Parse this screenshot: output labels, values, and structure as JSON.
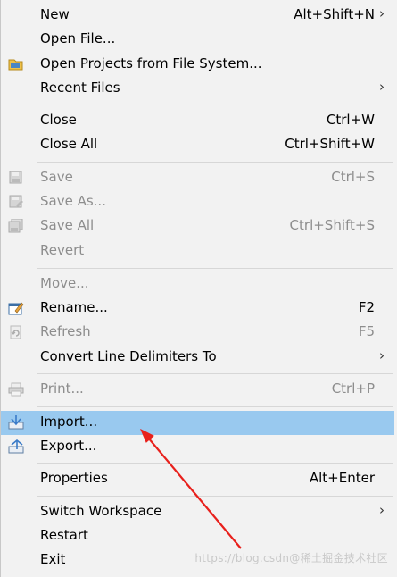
{
  "menu": {
    "new": {
      "label": "New",
      "shortcut": "Alt+Shift+N"
    },
    "open_file": {
      "label": "Open File..."
    },
    "open_projects": {
      "label": "Open Projects from File System..."
    },
    "recent_files": {
      "label": "Recent Files"
    },
    "close": {
      "label": "Close",
      "shortcut": "Ctrl+W"
    },
    "close_all": {
      "label": "Close All",
      "shortcut": "Ctrl+Shift+W"
    },
    "save": {
      "label": "Save",
      "shortcut": "Ctrl+S"
    },
    "save_as": {
      "label": "Save As..."
    },
    "save_all": {
      "label": "Save All",
      "shortcut": "Ctrl+Shift+S"
    },
    "revert": {
      "label": "Revert"
    },
    "move": {
      "label": "Move..."
    },
    "rename": {
      "label": "Rename...",
      "shortcut": "F2"
    },
    "refresh": {
      "label": "Refresh",
      "shortcut": "F5"
    },
    "convert": {
      "label": "Convert Line Delimiters To"
    },
    "print": {
      "label": "Print...",
      "shortcut": "Ctrl+P"
    },
    "import": {
      "label": "Import..."
    },
    "export": {
      "label": "Export..."
    },
    "properties": {
      "label": "Properties",
      "shortcut": "Alt+Enter"
    },
    "switch_workspace": {
      "label": "Switch Workspace"
    },
    "restart": {
      "label": "Restart"
    },
    "exit": {
      "label": "Exit"
    }
  },
  "submenu_arrow": "›",
  "watermark": "https://blog.csdn@稀土掘金技术社区",
  "colors": {
    "highlight": "#99c9ef",
    "annotation_arrow": "#e8201c",
    "disabled_text": "#8d8d8d"
  }
}
